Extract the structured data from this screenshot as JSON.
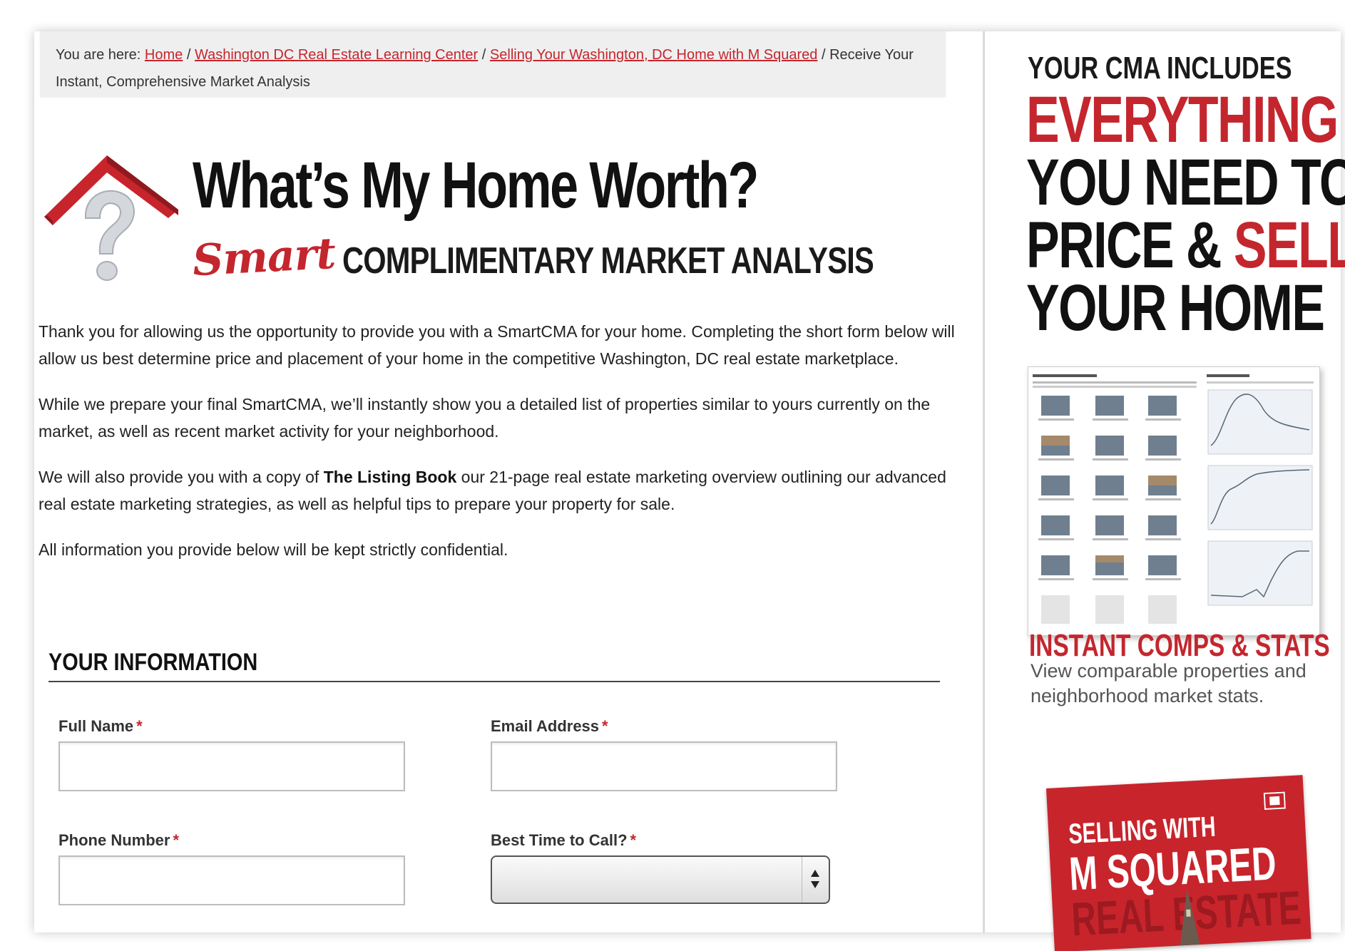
{
  "breadcrumb": {
    "prefix": "You are here:",
    "links": [
      "Home",
      "Washington DC Real Estate Learning Center",
      "Selling Your Washington, DC Home with M Squared"
    ],
    "separator": "/",
    "current": "Receive Your Instant, Comprehensive Market Analysis"
  },
  "hero": {
    "title": "What’s My Home Worth?",
    "subtitle_script": "Smart",
    "subtitle": "COMPLIMENTARY MARKET ANALYSIS",
    "icon": "house-question-icon"
  },
  "intro": {
    "p1": "Thank you for allowing us the opportunity to provide you with a SmartCMA for your home. Completing the short form below will allow us best determine price and placement of your home in the competitive Washington, DC real estate marketplace.",
    "p2": "While we prepare your final SmartCMA, we’ll instantly show you a detailed list of properties similar to yours currently on the market, as well as recent market activity for your neighborhood.",
    "p3_before": "We will also provide you with a copy of",
    "p3_bold": "The Listing Book",
    "p3_after": "our 21-page real estate marketing overview outlining our advanced real estate marketing strategies, as well as helpful tips to prepare your property for sale.",
    "p4": "All information you provide below will be kept strictly confidential."
  },
  "form": {
    "section_title": "YOUR INFORMATION",
    "required_marker": "*",
    "full_name": {
      "label": "Full Name",
      "value": ""
    },
    "email": {
      "label": "Email Address",
      "value": ""
    },
    "phone": {
      "label": "Phone Number",
      "value": ""
    },
    "best_time": {
      "label": "Best Time to Call?",
      "value": ""
    }
  },
  "sidebar": {
    "kicker": "YOUR CMA INCLUDES",
    "head_line1": "EVERYTHING",
    "head_line2": "YOU NEED TO",
    "head_line3a": "PRICE &",
    "head_line3b": "SELL",
    "head_line4": "YOUR HOME",
    "comps_title": "INSTANT COMPS & STATS",
    "comps_desc": "View comparable properties and neighborhood market stats.",
    "promo": {
      "line1": "SELLING WITH",
      "line2": "M SQUARED",
      "line3": "REAL ESTATE"
    }
  },
  "colors": {
    "accent": "#c4262e",
    "promo_bg": "#c8242c",
    "text": "#222222"
  }
}
